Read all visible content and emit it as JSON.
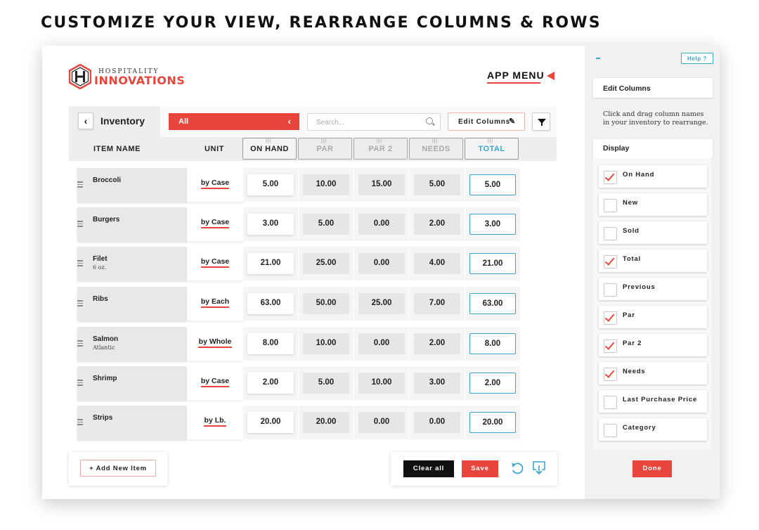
{
  "headline": "CUSTOMIZE YOUR VIEW, REARRANGE COLUMNS & ROWS",
  "logo": {
    "line1": "HOSPITALITY",
    "line2": "INNOVATIONS"
  },
  "app_menu_label": "APP MENU",
  "toolbar": {
    "back_icon": "chevron-left-icon",
    "title": "Inventory",
    "category_value": "All",
    "search_placeholder": "Search...",
    "edit_columns_label": "Edit Columns",
    "filter_icon": "filter-icon"
  },
  "columns": {
    "item_name": "ITEM NAME",
    "unit": "UNIT",
    "on_hand": "ON HAND",
    "par": "PAR",
    "par2": "PAR 2",
    "needs": "NEEDS",
    "total": "TOTAL"
  },
  "rows": [
    {
      "name": "Broccoli",
      "sub": "",
      "unit": "by Case",
      "on_hand": "5.00",
      "par": "10.00",
      "par2": "15.00",
      "needs": "5.00",
      "total": "5.00"
    },
    {
      "name": "Burgers",
      "sub": "",
      "unit": "by Case",
      "on_hand": "3.00",
      "par": "5.00",
      "par2": "0.00",
      "needs": "2.00",
      "total": "3.00"
    },
    {
      "name": "Filet",
      "sub": "6 oz.",
      "unit": "by Case",
      "on_hand": "21.00",
      "par": "25.00",
      "par2": "0.00",
      "needs": "4.00",
      "total": "21.00"
    },
    {
      "name": "Ribs",
      "sub": "",
      "unit": "by Each",
      "on_hand": "63.00",
      "par": "50.00",
      "par2": "25.00",
      "needs": "7.00",
      "total": "63.00"
    },
    {
      "name": "Salmon",
      "sub": "Atlantic",
      "unit": "by Whole",
      "on_hand": "8.00",
      "par": "10.00",
      "par2": "0.00",
      "needs": "2.00",
      "total": "8.00"
    },
    {
      "name": "Shrimp",
      "sub": "",
      "unit": "by Case",
      "on_hand": "2.00",
      "par": "5.00",
      "par2": "10.00",
      "needs": "3.00",
      "total": "2.00"
    },
    {
      "name": "Strips",
      "sub": "",
      "unit": "by Lb.",
      "on_hand": "20.00",
      "par": "20.00",
      "par2": "0.00",
      "needs": "0.00",
      "total": "20.00"
    }
  ],
  "bottom": {
    "add_new_label": "+ Add New Item",
    "clear_all_label": "Clear all",
    "save_label": "Save",
    "undo_icon": "undo-icon",
    "download_icon": "download-icon"
  },
  "side_panel": {
    "help_label": "Help ?",
    "edit_columns_title": "Edit Columns",
    "description": "Click and drag column names in your inventory to rearrange.",
    "display_title": "Display",
    "options": [
      {
        "label": "On Hand",
        "checked": true
      },
      {
        "label": "New",
        "checked": false
      },
      {
        "label": "Sold",
        "checked": false
      },
      {
        "label": "Total",
        "checked": true
      },
      {
        "label": "Previous",
        "checked": false
      },
      {
        "label": "Par",
        "checked": true
      },
      {
        "label": "Par 2",
        "checked": true
      },
      {
        "label": "Needs",
        "checked": true
      },
      {
        "label": "Last Purchase Price",
        "checked": false
      },
      {
        "label": "Category",
        "checked": false
      }
    ],
    "done_label": "Done"
  },
  "colors": {
    "accent": "#e8453c",
    "blue": "#39a6d0",
    "dark": "#111111"
  }
}
